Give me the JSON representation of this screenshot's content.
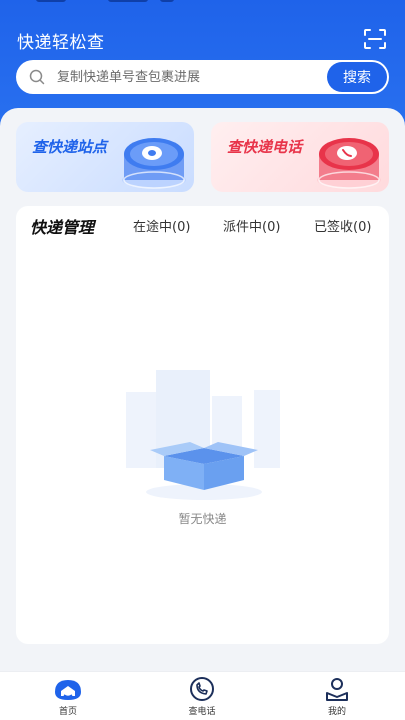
{
  "header": {
    "title": "快递轻松查",
    "scan_icon": "scan-icon"
  },
  "search": {
    "placeholder": "复制快递单号查包裹进展",
    "button_label": "搜索"
  },
  "cards": [
    {
      "label": "查快递站点",
      "icon": "station-disc-icon",
      "accent": "#1f63ea"
    },
    {
      "label": "查快递电话",
      "icon": "phone-disc-icon",
      "accent": "#e8344a"
    }
  ],
  "manage": {
    "title": "快递管理",
    "tabs": [
      {
        "label": "在途中(0)"
      },
      {
        "label": "派件中(0)"
      },
      {
        "label": "已签收(0)"
      }
    ],
    "empty_text": "暂无快递"
  },
  "bottom_nav": [
    {
      "label": "首页",
      "icon": "home-icon",
      "active": true
    },
    {
      "label": "查电话",
      "icon": "phone-icon",
      "active": false
    },
    {
      "label": "我的",
      "icon": "profile-icon",
      "active": false
    }
  ],
  "colors": {
    "brand_blue": "#1f63ea",
    "accent_red": "#e8344a",
    "background": "#f2f4f8"
  }
}
